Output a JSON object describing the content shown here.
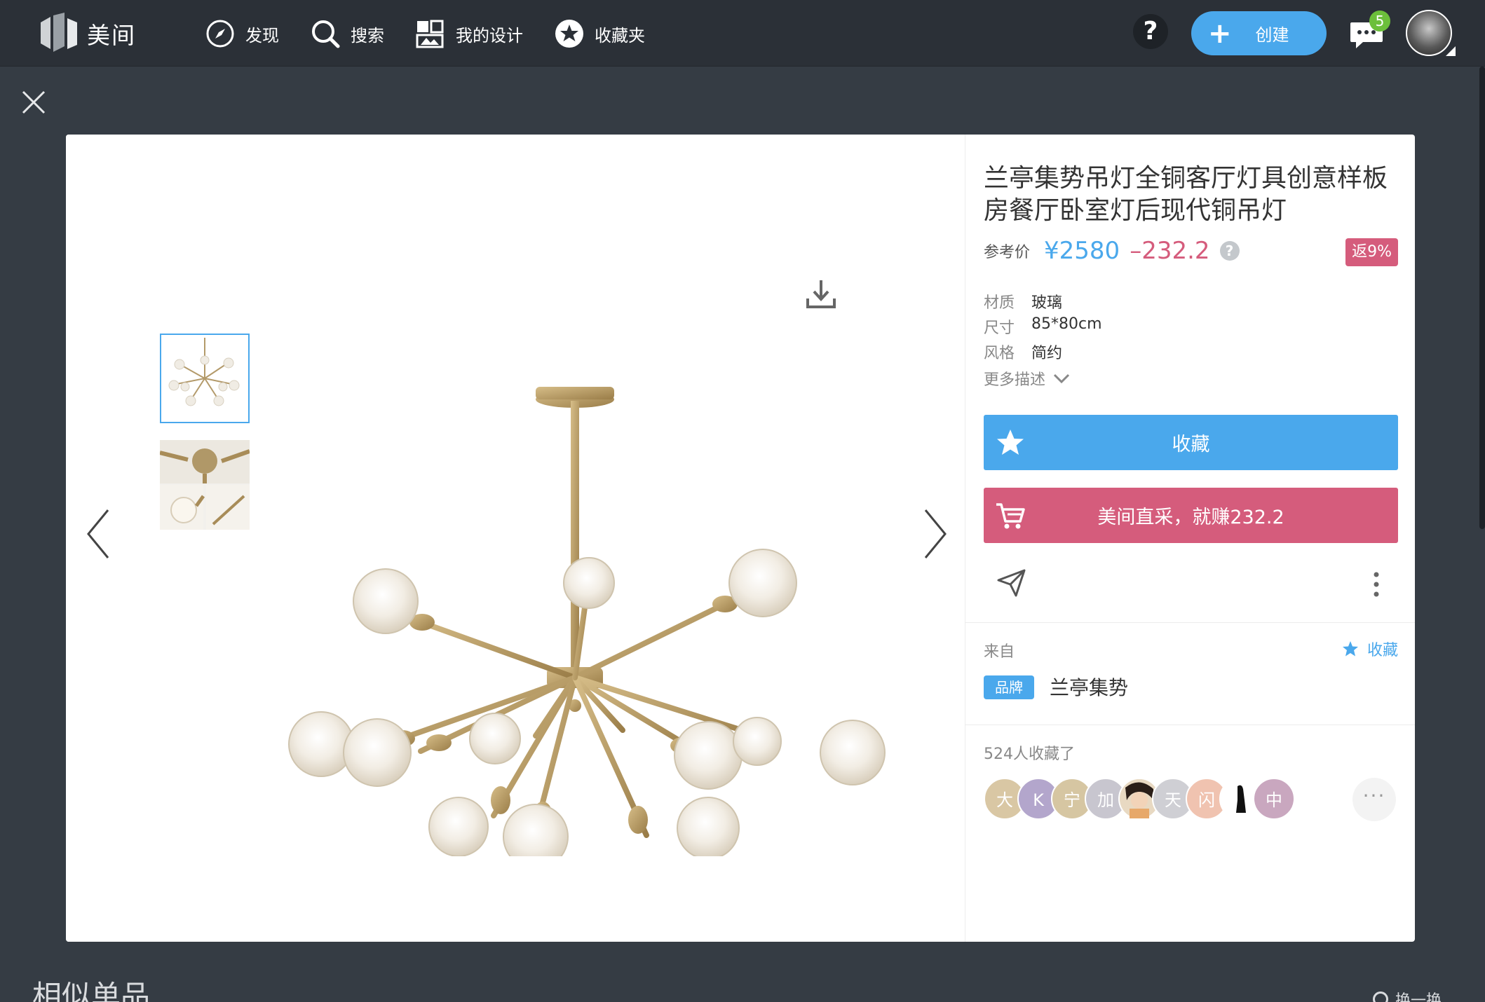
{
  "app": {
    "brand_name": "美间"
  },
  "nav": {
    "items": [
      {
        "label": "发现",
        "icon": "compass-icon"
      },
      {
        "label": "搜索",
        "icon": "search-icon"
      },
      {
        "label": "我的设计",
        "icon": "design-icon"
      },
      {
        "label": "收藏夹",
        "icon": "star-icon"
      }
    ],
    "help_label": "?",
    "create_label": "创建",
    "message_count": "5"
  },
  "viewer": {
    "thumbnails": [
      "thumbnail-chandelier",
      "thumbnail-details"
    ],
    "active_thumbnail": 0
  },
  "product": {
    "title": "兰亭集势吊灯全铜客厅灯具创意样板房餐厅卧室灯后现代铜吊灯",
    "price_label": "参考价",
    "price": "¥2580",
    "discount": "–232.2",
    "rebate": "返9%",
    "specs": [
      {
        "key": "材质",
        "value": "玻璃"
      },
      {
        "key": "尺寸",
        "value": "85*80cm"
      },
      {
        "key": "风格",
        "value": "简约"
      }
    ],
    "more_label": "更多描述",
    "collect_button": "收藏",
    "buy_button": "美间直采，就赚232.2"
  },
  "source": {
    "from_label": "来自",
    "collect_label": "收藏",
    "brand_tag": "品牌",
    "brand_name": "兰亭集势"
  },
  "collectors": {
    "count_text": "524人收藏了",
    "avatars": [
      {
        "text": "大",
        "color": "#d9c7a4"
      },
      {
        "text": "K",
        "color": "#b3a6cc"
      },
      {
        "text": "宁",
        "color": "#d6c6a2"
      },
      {
        "text": "加",
        "color": "#c8c6cf"
      },
      {
        "text": "",
        "color": "#e8d9c2"
      },
      {
        "text": "天",
        "color": "#cfcfd4"
      },
      {
        "text": "闪",
        "color": "#f0c3b0"
      },
      {
        "text": "",
        "color": "#ffffff"
      },
      {
        "text": "中",
        "color": "#c9a7bf"
      }
    ],
    "more_label": "···"
  },
  "below": {
    "similar_title": "相似单品",
    "refresh_label": "换一换"
  },
  "colors": {
    "accent_blue": "#4aa8ec",
    "accent_pink": "#d55c7c",
    "topbar_bg": "#2b3037",
    "page_bg": "#353c44"
  }
}
